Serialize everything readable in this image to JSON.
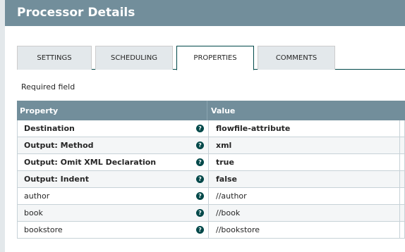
{
  "dialog": {
    "title": "Processor Details"
  },
  "tabs": [
    {
      "label": "SETTINGS"
    },
    {
      "label": "SCHEDULING"
    },
    {
      "label": "PROPERTIES"
    },
    {
      "label": "COMMENTS"
    }
  ],
  "required_label": "Required field",
  "grid": {
    "headers": {
      "property": "Property",
      "value": "Value"
    },
    "help_icon": "question-circle",
    "rows": [
      {
        "name": "Destination",
        "value": "flowfile-attribute"
      },
      {
        "name": "Output: Method",
        "value": "xml"
      },
      {
        "name": "Output: Omit XML Declaration",
        "value": "true"
      },
      {
        "name": "Output: Indent",
        "value": "false"
      },
      {
        "name": "author",
        "value": "//author"
      },
      {
        "name": "book",
        "value": "//book"
      },
      {
        "name": "bookstore",
        "value": "//bookstore"
      }
    ]
  },
  "colors": {
    "header": "#728e9b",
    "accent": "#004849"
  }
}
